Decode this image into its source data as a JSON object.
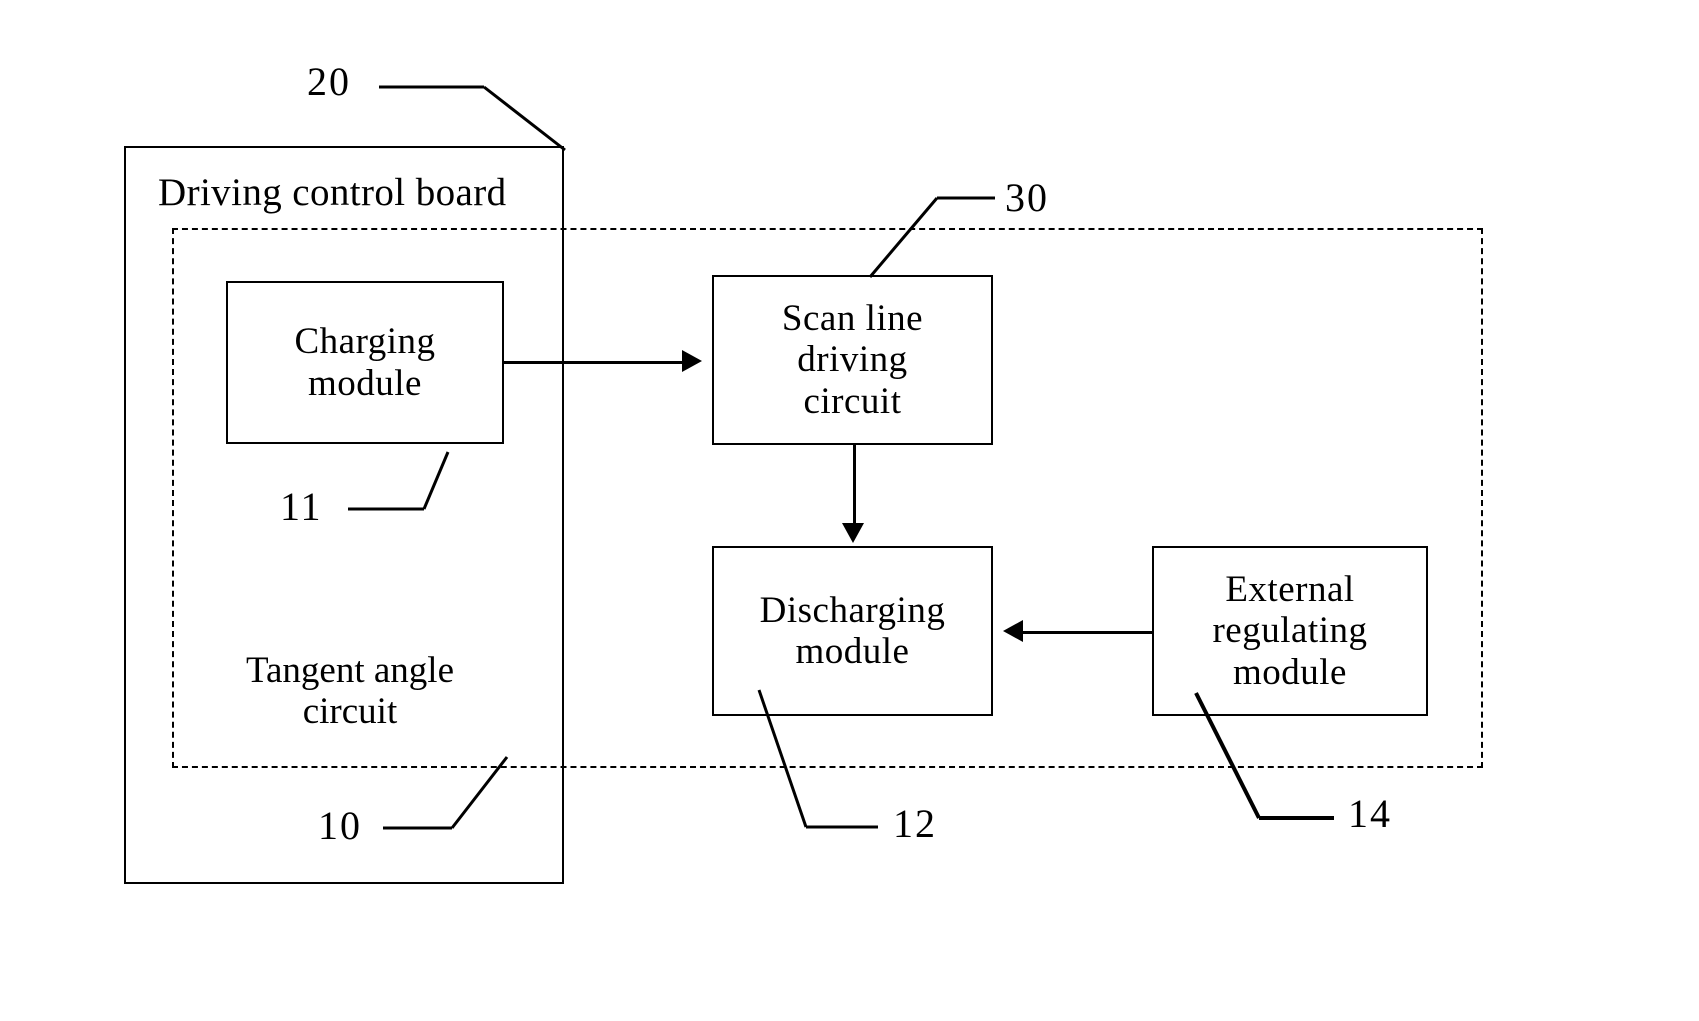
{
  "figure": {
    "type": "patent-block-diagram",
    "background": "#ffffff",
    "line_color": "#000000"
  },
  "containers": {
    "driving_control_board": {
      "label": "Driving control board",
      "ref": "20",
      "border": "solid"
    },
    "tangent_angle_circuit": {
      "label": "Tangent angle\ncircuit",
      "ref": "10",
      "border": "dashed"
    }
  },
  "blocks": [
    {
      "id": "charging-module",
      "label": "Charging\nmodule",
      "ref": "11"
    },
    {
      "id": "scan-line-circuit",
      "label": "Scan line\ndriving\ncircuit",
      "ref": "30"
    },
    {
      "id": "discharging-module",
      "label": "Discharging\nmodule",
      "ref": "12"
    },
    {
      "id": "external-regulating-module",
      "label": "External\nregulating\nmodule",
      "ref": "14"
    }
  ],
  "reference_numerals": {
    "board": "20",
    "scan_line": "30",
    "charging": "11",
    "tangent": "10",
    "discharging": "12",
    "external": "14"
  },
  "connections": [
    {
      "from": "charging-module",
      "to": "scan-line-circuit",
      "direction": "right"
    },
    {
      "from": "scan-line-circuit",
      "to": "discharging-module",
      "direction": "down"
    },
    {
      "from": "external-regulating-module",
      "to": "discharging-module",
      "direction": "left"
    }
  ]
}
